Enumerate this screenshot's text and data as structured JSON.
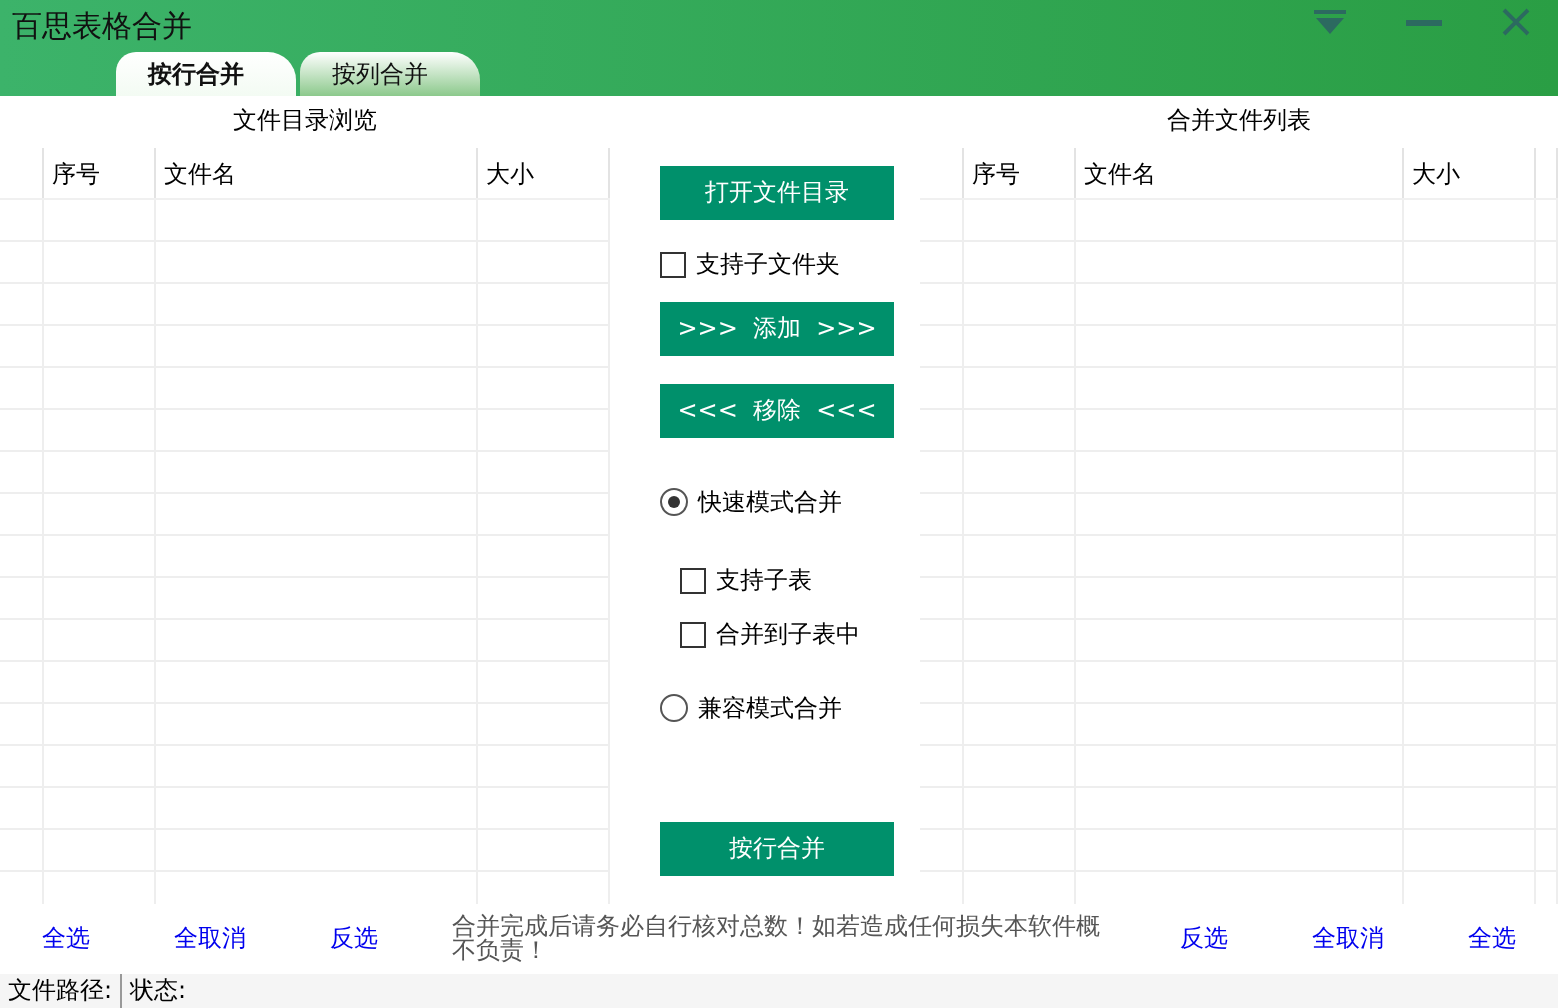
{
  "window": {
    "title": "百思表格合并"
  },
  "tabs": [
    {
      "label": "按行合并",
      "selected": true
    },
    {
      "label": "按列合并",
      "selected": false
    }
  ],
  "left_panel": {
    "title": "文件目录浏览",
    "columns": [
      "序号",
      "文件名",
      "大小"
    ],
    "links": [
      "全选",
      "全取消",
      "反选"
    ]
  },
  "controls": [
    {
      "kind": "button",
      "label": "打开文件目录"
    },
    {
      "kind": "checkbox",
      "label": "支持子文件夹",
      "checked": false
    },
    {
      "kind": "button",
      "label": ">>>  添加  >>>"
    },
    {
      "kind": "button",
      "label": "<<<  移除  <<<"
    },
    {
      "kind": "radio",
      "label": "快速模式合并",
      "selected": true,
      "children": [
        {
          "kind": "checkbox",
          "label": "支持子表",
          "checked": false
        },
        {
          "kind": "checkbox",
          "label": "合并到子表中",
          "checked": false
        }
      ]
    },
    {
      "kind": "radio",
      "label": "兼容模式合并",
      "selected": false
    },
    {
      "kind": "button",
      "label": "按行合并"
    }
  ],
  "notice": "合并完成后请务必自行核对总数！如若造成任何损失本软件概不负责！",
  "right_panel": {
    "title": "合并文件列表",
    "columns": [
      "序号",
      "文件名",
      "大小"
    ],
    "links": [
      "反选",
      "全取消",
      "全选"
    ]
  },
  "status_bar": {
    "path_label": "文件路径:",
    "status_label": "状态:"
  }
}
